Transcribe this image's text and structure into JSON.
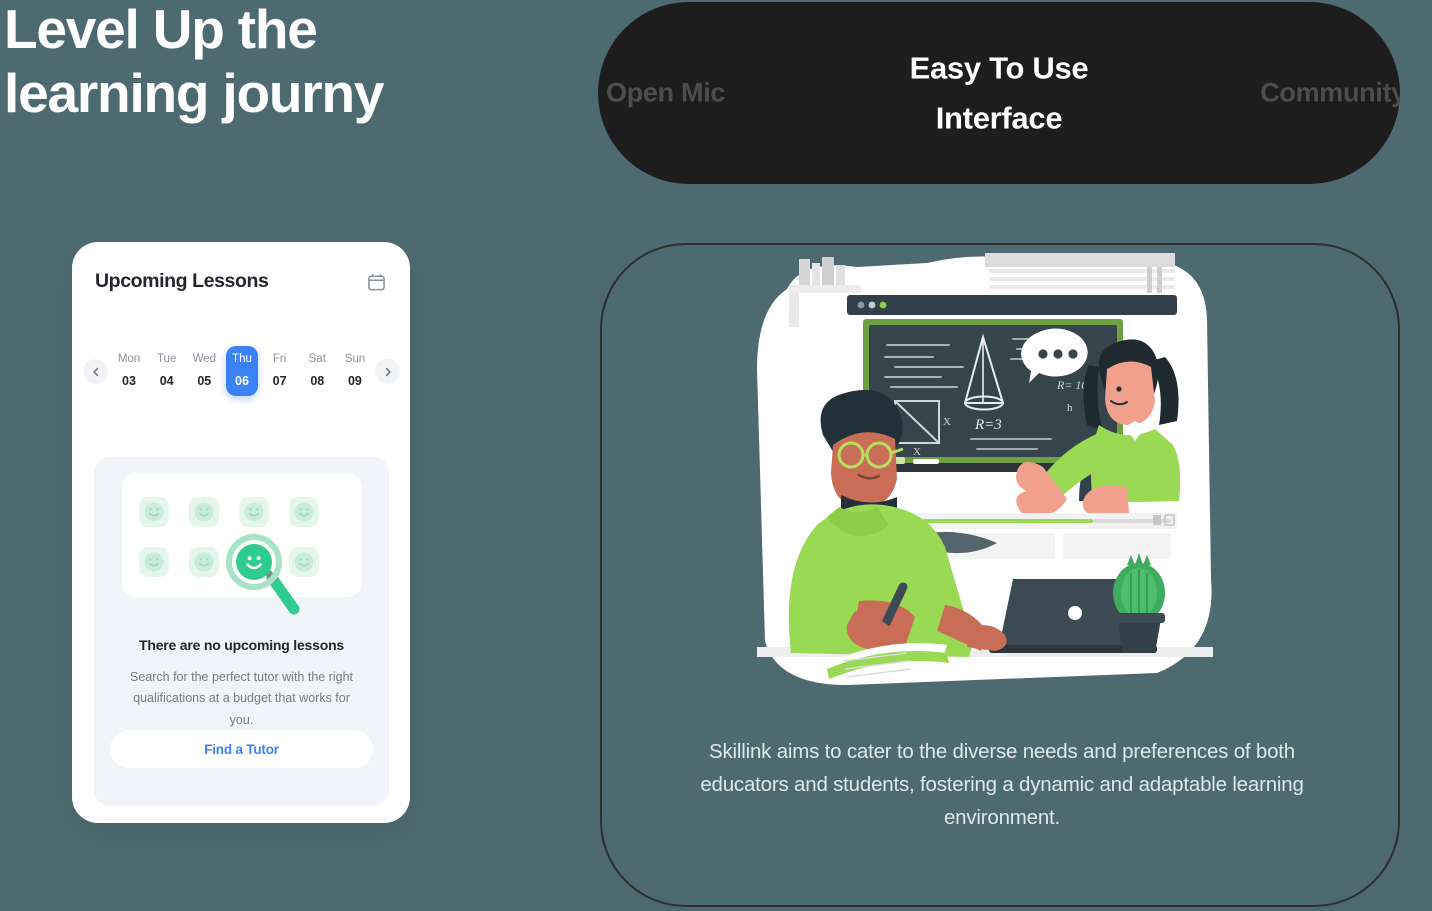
{
  "theme": {
    "background": "#4d6a71",
    "accent_blue": "#3b82f6",
    "accent_green": "#2ecc8f",
    "dark_pill": "#1d1d1d",
    "panel_border": "#2f2f2f"
  },
  "headline": {
    "line1": "Level Up the",
    "line2": "learning journy"
  },
  "tabs": {
    "left_label": "Open Mic",
    "active_label_line1": "Easy To Use",
    "active_label_line2": "Interface",
    "right_label": "Community"
  },
  "lesson_card": {
    "title": "Upcoming Lessons",
    "calendar_icon": "calendar-icon",
    "prev_icon": "chevron-left-icon",
    "next_icon": "chevron-right-icon",
    "days": [
      {
        "dow": "Mon",
        "num": "03",
        "selected": false
      },
      {
        "dow": "Tue",
        "num": "04",
        "selected": false
      },
      {
        "dow": "Wed",
        "num": "05",
        "selected": false
      },
      {
        "dow": "Thu",
        "num": "06",
        "selected": true
      },
      {
        "dow": "Fri",
        "num": "07",
        "selected": false
      },
      {
        "dow": "Sat",
        "num": "08",
        "selected": false
      },
      {
        "dow": "Sun",
        "num": "09",
        "selected": false
      }
    ],
    "empty_state": {
      "illustration": "smiley-grid-with-magnifier-illustration",
      "title": "There are no upcoming lessons",
      "description": "Search for the perfect tutor with the right qualifications at a budget that works for you.",
      "button_label": "Find a Tutor"
    }
  },
  "feature": {
    "illustration": "online-classroom-illustration",
    "description": "Skillink aims to cater to the diverse needs and preferences of both educators and students, fostering a dynamic and adaptable learning environment."
  }
}
